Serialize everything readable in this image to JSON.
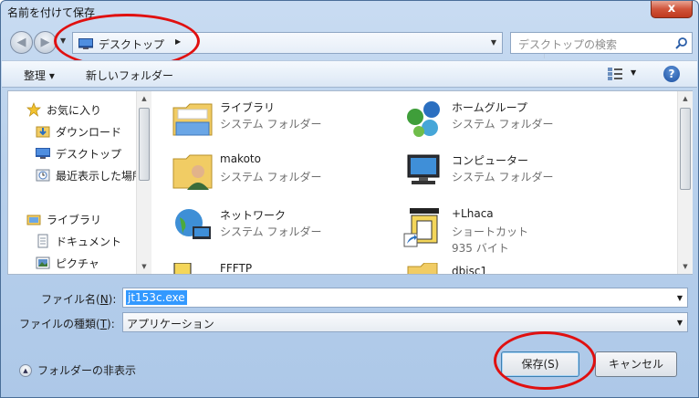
{
  "window": {
    "title": "名前を付けて保存",
    "close_label": "x"
  },
  "navbar": {
    "address_location": "デスクトップ",
    "search_placeholder": "デスクトップの検索"
  },
  "toolbar": {
    "organize_label": "整理 ▾",
    "new_folder_label": "新しいフォルダー"
  },
  "nav_pane": {
    "items": [
      {
        "label": "お気に入り",
        "icon": "star-icon"
      },
      {
        "label": "ダウンロード",
        "icon": "downloads-folder-icon"
      },
      {
        "label": "デスクトップ",
        "icon": "desktop-icon"
      },
      {
        "label": "最近表示した場所",
        "icon": "recent-places-icon"
      },
      {
        "label": "ライブラリ",
        "icon": "libraries-icon"
      },
      {
        "label": "ドキュメント",
        "icon": "documents-icon"
      },
      {
        "label": "ピクチャ",
        "icon": "pictures-icon"
      }
    ]
  },
  "files": [
    {
      "name": "ライブラリ",
      "type": "システム フォルダー",
      "icon": "libraries-folder-icon"
    },
    {
      "name": "ホームグループ",
      "type": "システム フォルダー",
      "icon": "homegroup-icon"
    },
    {
      "name": "makoto",
      "type": "システム フォルダー",
      "icon": "user-folder-icon"
    },
    {
      "name": "コンピューター",
      "type": "システム フォルダー",
      "icon": "computer-icon"
    },
    {
      "name": "ネットワーク",
      "type": "システム フォルダー",
      "icon": "network-icon"
    },
    {
      "name": "+Lhaca",
      "type": "ショートカット",
      "size": "935 バイト",
      "icon": "shortcut-icon"
    },
    {
      "name": "FFFTP",
      "type": "",
      "icon": "app-icon"
    },
    {
      "name": "dbisc1",
      "type": "",
      "icon": "folder-icon"
    }
  ],
  "form": {
    "filename_label_prefix": "ファイル名(",
    "filename_accel": "N",
    "filename_label_suffix": "):",
    "filename_value": "jt153c.exe",
    "filetype_label_prefix": "ファイルの種類(",
    "filetype_accel": "T",
    "filetype_label_suffix": "):",
    "filetype_value": "アプリケーション"
  },
  "footer": {
    "hide_folders_label": "フォルダーの非表示",
    "save_label": "保存(S)",
    "cancel_label": "キャンセル"
  },
  "colors": {
    "highlight_ring": "#e01010",
    "selection": "#3399ff"
  }
}
